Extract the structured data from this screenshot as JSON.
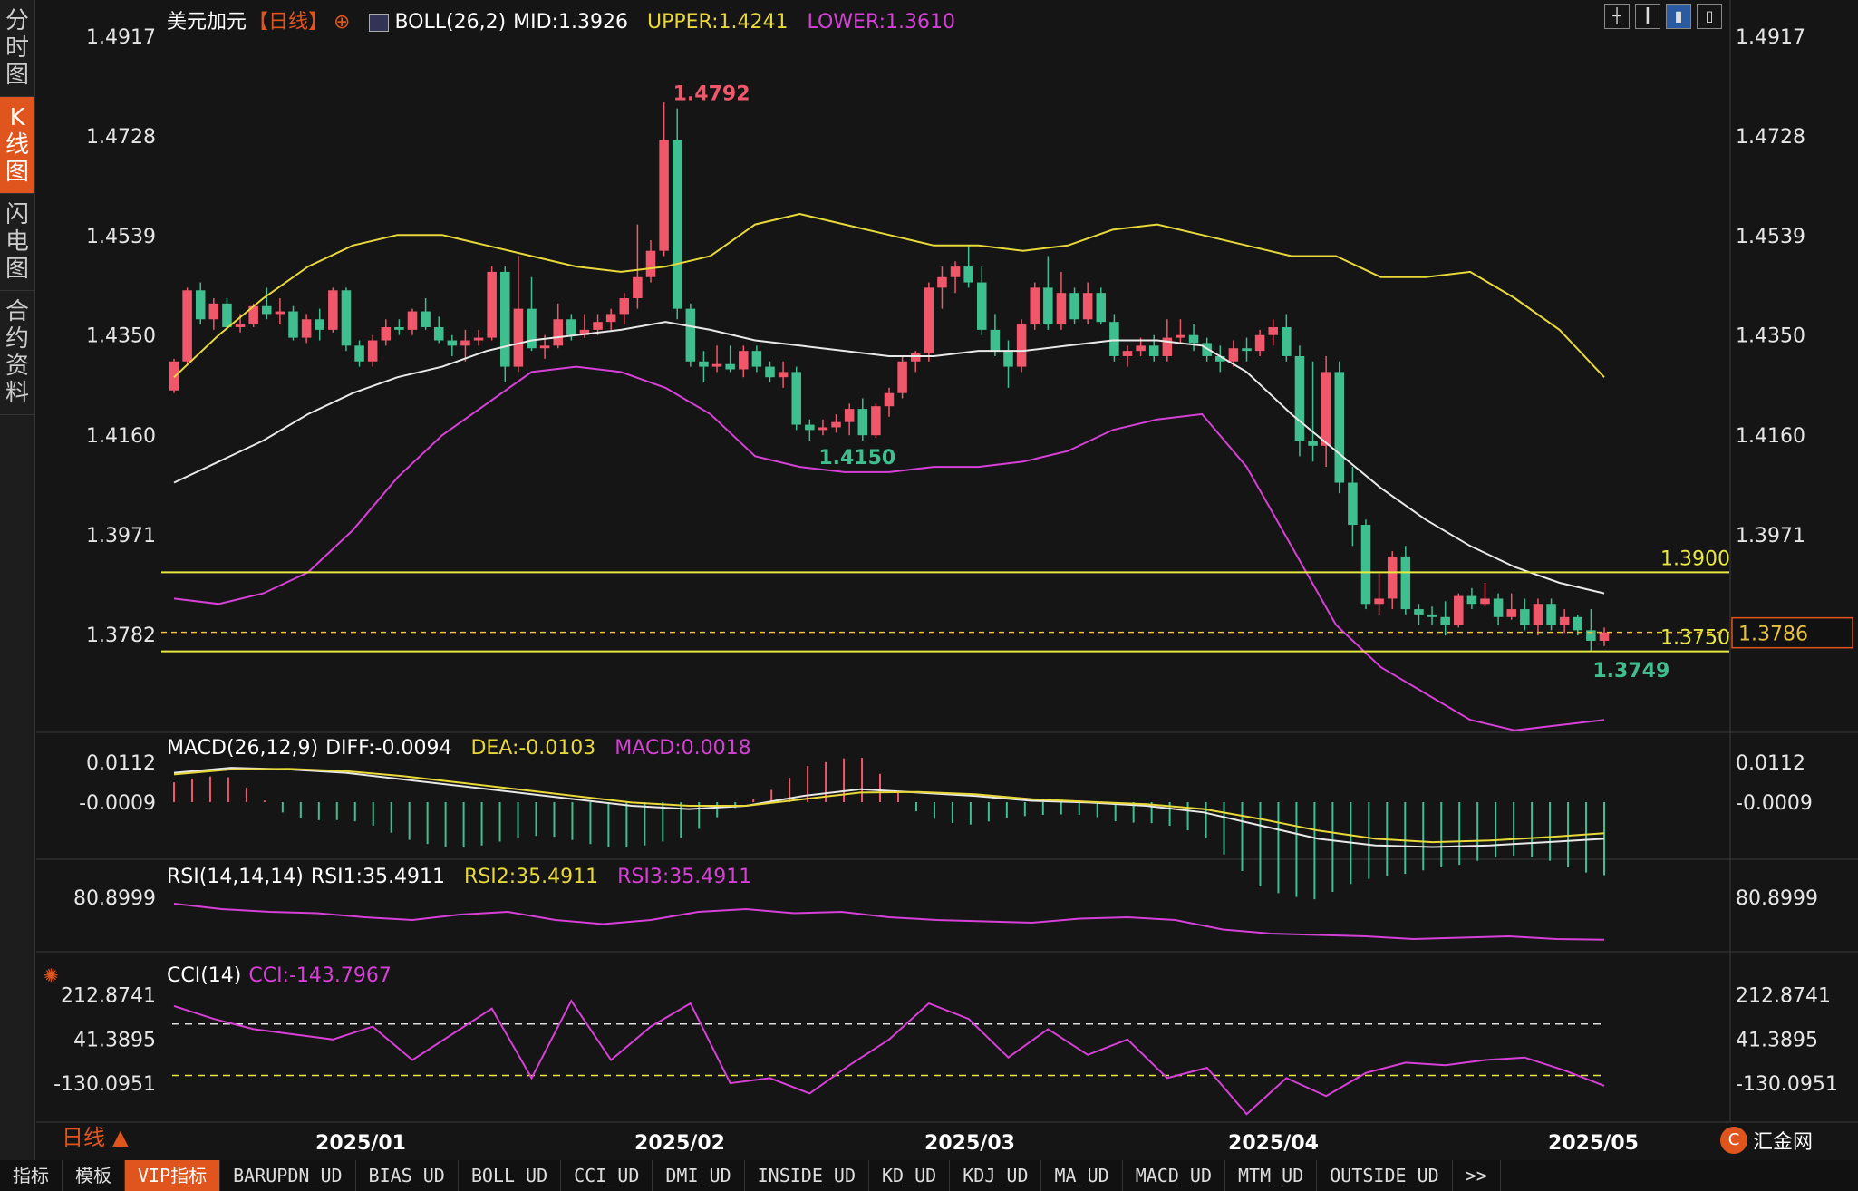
{
  "sidebar": {
    "tabs": [
      {
        "label": "分时图",
        "active": false
      },
      {
        "label": "K线图",
        "active": true
      },
      {
        "label": "闪电图",
        "active": false
      },
      {
        "label": "合约资料",
        "active": false
      }
    ]
  },
  "legend": {
    "symbol": "美元加元",
    "period": "【日线】",
    "boll_name": "BOLL(26,2)",
    "boll_mid": "MID:1.3926",
    "boll_upper": "UPPER:1.4241",
    "boll_lower": "LOWER:1.3610",
    "macd_name": "MACD(26,12,9)",
    "macd_diff": "DIFF:-0.0094",
    "macd_dea": "DEA:-0.0103",
    "macd_macd": "MACD:0.0018",
    "rsi_name": "RSI(14,14,14)",
    "rsi1": "RSI1:35.4911",
    "rsi2": "RSI2:35.4911",
    "rsi3": "RSI3:35.4911",
    "cci_name": "CCI(14)",
    "cci_val": "CCI:-143.7967"
  },
  "colors": {
    "up": "#f0576a",
    "down": "#3fbf8f",
    "upper": "#e8d83a",
    "mid": "#e8e8e8",
    "lower": "#d640d6",
    "hline": "#e8e840",
    "accent": "#e0551d"
  },
  "price_axis": [
    "1.4917",
    "1.4728",
    "1.4539",
    "1.4350",
    "1.4160",
    "1.3971",
    "1.3782"
  ],
  "macd_axis": [
    "0.0112",
    "-0.0009"
  ],
  "rsi_axis": [
    "80.8999"
  ],
  "cci_axis": [
    "212.8741",
    "41.3895",
    "-130.0951"
  ],
  "date_labels": [
    "2025/01",
    "2025/02",
    "2025/03",
    "2025/04",
    "2025/05"
  ],
  "annotations": {
    "high": "1.4792",
    "low_feb": "1.4150",
    "low_may": "1.3749",
    "hline_1": "1.3900",
    "hline_2": "1.3750",
    "current": "1.3786"
  },
  "chart_data": {
    "type": "candlestick",
    "price_range": [
      1.361,
      1.4917
    ],
    "highlights": {
      "high": 1.4792,
      "low_feb": 1.415,
      "low_may": 1.3749,
      "current": 1.3786
    },
    "horizontal_lines": [
      1.39,
      1.375
    ],
    "candles": [
      {
        "o": 1.4245,
        "h": 1.4305,
        "l": 1.424,
        "c": 1.43
      },
      {
        "o": 1.43,
        "h": 1.444,
        "l": 1.4295,
        "c": 1.4435
      },
      {
        "o": 1.4435,
        "h": 1.445,
        "l": 1.437,
        "c": 1.438
      },
      {
        "o": 1.438,
        "h": 1.442,
        "l": 1.436,
        "c": 1.441
      },
      {
        "o": 1.441,
        "h": 1.442,
        "l": 1.436,
        "c": 1.4365
      },
      {
        "o": 1.4365,
        "h": 1.439,
        "l": 1.4355,
        "c": 1.437
      },
      {
        "o": 1.437,
        "h": 1.441,
        "l": 1.4365,
        "c": 1.4405
      },
      {
        "o": 1.4405,
        "h": 1.444,
        "l": 1.438,
        "c": 1.439
      },
      {
        "o": 1.439,
        "h": 1.442,
        "l": 1.437,
        "c": 1.4395
      },
      {
        "o": 1.4395,
        "h": 1.4405,
        "l": 1.434,
        "c": 1.4345
      },
      {
        "o": 1.4345,
        "h": 1.439,
        "l": 1.4335,
        "c": 1.438
      },
      {
        "o": 1.438,
        "h": 1.44,
        "l": 1.434,
        "c": 1.436
      },
      {
        "o": 1.436,
        "h": 1.444,
        "l": 1.4355,
        "c": 1.4435
      },
      {
        "o": 1.4435,
        "h": 1.444,
        "l": 1.432,
        "c": 1.433
      },
      {
        "o": 1.433,
        "h": 1.434,
        "l": 1.429,
        "c": 1.43
      },
      {
        "o": 1.43,
        "h": 1.435,
        "l": 1.429,
        "c": 1.434
      },
      {
        "o": 1.434,
        "h": 1.438,
        "l": 1.433,
        "c": 1.4365
      },
      {
        "o": 1.4365,
        "h": 1.438,
        "l": 1.435,
        "c": 1.436
      },
      {
        "o": 1.436,
        "h": 1.44,
        "l": 1.435,
        "c": 1.4395
      },
      {
        "o": 1.4395,
        "h": 1.442,
        "l": 1.436,
        "c": 1.4365
      },
      {
        "o": 1.4365,
        "h": 1.4385,
        "l": 1.4335,
        "c": 1.434
      },
      {
        "o": 1.434,
        "h": 1.435,
        "l": 1.431,
        "c": 1.433
      },
      {
        "o": 1.433,
        "h": 1.436,
        "l": 1.43,
        "c": 1.434
      },
      {
        "o": 1.434,
        "h": 1.436,
        "l": 1.433,
        "c": 1.4345
      },
      {
        "o": 1.4345,
        "h": 1.448,
        "l": 1.434,
        "c": 1.447
      },
      {
        "o": 1.447,
        "h": 1.448,
        "l": 1.426,
        "c": 1.429
      },
      {
        "o": 1.429,
        "h": 1.45,
        "l": 1.428,
        "c": 1.44
      },
      {
        "o": 1.44,
        "h": 1.446,
        "l": 1.432,
        "c": 1.4325
      },
      {
        "o": 1.4325,
        "h": 1.435,
        "l": 1.4305,
        "c": 1.433
      },
      {
        "o": 1.433,
        "h": 1.441,
        "l": 1.4325,
        "c": 1.438
      },
      {
        "o": 1.438,
        "h": 1.439,
        "l": 1.434,
        "c": 1.435
      },
      {
        "o": 1.435,
        "h": 1.439,
        "l": 1.4345,
        "c": 1.436
      },
      {
        "o": 1.436,
        "h": 1.439,
        "l": 1.435,
        "c": 1.4375
      },
      {
        "o": 1.4375,
        "h": 1.44,
        "l": 1.436,
        "c": 1.439
      },
      {
        "o": 1.439,
        "h": 1.443,
        "l": 1.437,
        "c": 1.442
      },
      {
        "o": 1.442,
        "h": 1.456,
        "l": 1.44,
        "c": 1.446
      },
      {
        "o": 1.446,
        "h": 1.453,
        "l": 1.445,
        "c": 1.451
      },
      {
        "o": 1.451,
        "h": 1.4792,
        "l": 1.45,
        "c": 1.472
      },
      {
        "o": 1.472,
        "h": 1.478,
        "l": 1.438,
        "c": 1.44
      },
      {
        "o": 1.44,
        "h": 1.441,
        "l": 1.429,
        "c": 1.43
      },
      {
        "o": 1.43,
        "h": 1.432,
        "l": 1.426,
        "c": 1.429
      },
      {
        "o": 1.429,
        "h": 1.433,
        "l": 1.428,
        "c": 1.4295
      },
      {
        "o": 1.4295,
        "h": 1.433,
        "l": 1.428,
        "c": 1.4285
      },
      {
        "o": 1.4285,
        "h": 1.433,
        "l": 1.427,
        "c": 1.432
      },
      {
        "o": 1.432,
        "h": 1.433,
        "l": 1.428,
        "c": 1.429
      },
      {
        "o": 1.429,
        "h": 1.43,
        "l": 1.426,
        "c": 1.427
      },
      {
        "o": 1.427,
        "h": 1.43,
        "l": 1.425,
        "c": 1.428
      },
      {
        "o": 1.428,
        "h": 1.429,
        "l": 1.417,
        "c": 1.418
      },
      {
        "o": 1.418,
        "h": 1.419,
        "l": 1.415,
        "c": 1.417
      },
      {
        "o": 1.417,
        "h": 1.419,
        "l": 1.416,
        "c": 1.4175
      },
      {
        "o": 1.4175,
        "h": 1.42,
        "l": 1.4165,
        "c": 1.4185
      },
      {
        "o": 1.4185,
        "h": 1.422,
        "l": 1.416,
        "c": 1.421
      },
      {
        "o": 1.421,
        "h": 1.423,
        "l": 1.415,
        "c": 1.416
      },
      {
        "o": 1.416,
        "h": 1.422,
        "l": 1.4155,
        "c": 1.4215
      },
      {
        "o": 1.4215,
        "h": 1.425,
        "l": 1.4195,
        "c": 1.424
      },
      {
        "o": 1.424,
        "h": 1.431,
        "l": 1.423,
        "c": 1.43
      },
      {
        "o": 1.43,
        "h": 1.432,
        "l": 1.428,
        "c": 1.4315
      },
      {
        "o": 1.4315,
        "h": 1.445,
        "l": 1.43,
        "c": 1.444
      },
      {
        "o": 1.444,
        "h": 1.448,
        "l": 1.44,
        "c": 1.446
      },
      {
        "o": 1.446,
        "h": 1.449,
        "l": 1.443,
        "c": 1.448
      },
      {
        "o": 1.448,
        "h": 1.452,
        "l": 1.444,
        "c": 1.445
      },
      {
        "o": 1.445,
        "h": 1.448,
        "l": 1.435,
        "c": 1.436
      },
      {
        "o": 1.436,
        "h": 1.439,
        "l": 1.431,
        "c": 1.432
      },
      {
        "o": 1.432,
        "h": 1.434,
        "l": 1.425,
        "c": 1.429
      },
      {
        "o": 1.429,
        "h": 1.438,
        "l": 1.428,
        "c": 1.437
      },
      {
        "o": 1.437,
        "h": 1.445,
        "l": 1.436,
        "c": 1.444
      },
      {
        "o": 1.444,
        "h": 1.45,
        "l": 1.436,
        "c": 1.437
      },
      {
        "o": 1.437,
        "h": 1.447,
        "l": 1.436,
        "c": 1.443
      },
      {
        "o": 1.443,
        "h": 1.444,
        "l": 1.437,
        "c": 1.438
      },
      {
        "o": 1.438,
        "h": 1.445,
        "l": 1.437,
        "c": 1.443
      },
      {
        "o": 1.443,
        "h": 1.444,
        "l": 1.437,
        "c": 1.4375
      },
      {
        "o": 1.4375,
        "h": 1.439,
        "l": 1.43,
        "c": 1.431
      },
      {
        "o": 1.431,
        "h": 1.433,
        "l": 1.429,
        "c": 1.432
      },
      {
        "o": 1.432,
        "h": 1.4345,
        "l": 1.431,
        "c": 1.433
      },
      {
        "o": 1.433,
        "h": 1.435,
        "l": 1.43,
        "c": 1.431
      },
      {
        "o": 1.431,
        "h": 1.438,
        "l": 1.43,
        "c": 1.4345
      },
      {
        "o": 1.4345,
        "h": 1.438,
        "l": 1.4335,
        "c": 1.435
      },
      {
        "o": 1.435,
        "h": 1.437,
        "l": 1.432,
        "c": 1.4335
      },
      {
        "o": 1.4335,
        "h": 1.4345,
        "l": 1.43,
        "c": 1.431
      },
      {
        "o": 1.431,
        "h": 1.433,
        "l": 1.428,
        "c": 1.43
      },
      {
        "o": 1.43,
        "h": 1.434,
        "l": 1.429,
        "c": 1.4325
      },
      {
        "o": 1.4325,
        "h": 1.4345,
        "l": 1.43,
        "c": 1.432
      },
      {
        "o": 1.432,
        "h": 1.436,
        "l": 1.431,
        "c": 1.435
      },
      {
        "o": 1.435,
        "h": 1.438,
        "l": 1.433,
        "c": 1.4365
      },
      {
        "o": 1.4365,
        "h": 1.439,
        "l": 1.43,
        "c": 1.431
      },
      {
        "o": 1.431,
        "h": 1.433,
        "l": 1.412,
        "c": 1.415
      },
      {
        "o": 1.415,
        "h": 1.43,
        "l": 1.411,
        "c": 1.414
      },
      {
        "o": 1.414,
        "h": 1.431,
        "l": 1.41,
        "c": 1.428
      },
      {
        "o": 1.428,
        "h": 1.43,
        "l": 1.405,
        "c": 1.407
      },
      {
        "o": 1.407,
        "h": 1.41,
        "l": 1.395,
        "c": 1.399
      },
      {
        "o": 1.399,
        "h": 1.4,
        "l": 1.383,
        "c": 1.384
      },
      {
        "o": 1.384,
        "h": 1.39,
        "l": 1.382,
        "c": 1.385
      },
      {
        "o": 1.385,
        "h": 1.394,
        "l": 1.383,
        "c": 1.393
      },
      {
        "o": 1.393,
        "h": 1.395,
        "l": 1.382,
        "c": 1.383
      },
      {
        "o": 1.383,
        "h": 1.384,
        "l": 1.38,
        "c": 1.382
      },
      {
        "o": 1.382,
        "h": 1.3835,
        "l": 1.38,
        "c": 1.3815
      },
      {
        "o": 1.3815,
        "h": 1.3845,
        "l": 1.378,
        "c": 1.38
      },
      {
        "o": 1.38,
        "h": 1.386,
        "l": 1.3795,
        "c": 1.3855
      },
      {
        "o": 1.3855,
        "h": 1.387,
        "l": 1.383,
        "c": 1.384
      },
      {
        "o": 1.384,
        "h": 1.388,
        "l": 1.3835,
        "c": 1.385
      },
      {
        "o": 1.385,
        "h": 1.386,
        "l": 1.38,
        "c": 1.3815
      },
      {
        "o": 1.3815,
        "h": 1.386,
        "l": 1.381,
        "c": 1.383
      },
      {
        "o": 1.383,
        "h": 1.385,
        "l": 1.379,
        "c": 1.38
      },
      {
        "o": 1.38,
        "h": 1.385,
        "l": 1.378,
        "c": 1.384
      },
      {
        "o": 1.384,
        "h": 1.385,
        "l": 1.379,
        "c": 1.38
      },
      {
        "o": 1.38,
        "h": 1.383,
        "l": 1.3785,
        "c": 1.3815
      },
      {
        "o": 1.3815,
        "h": 1.382,
        "l": 1.378,
        "c": 1.379
      },
      {
        "o": 1.379,
        "h": 1.383,
        "l": 1.3749,
        "c": 1.377
      },
      {
        "o": 1.377,
        "h": 1.3795,
        "l": 1.376,
        "c": 1.3786
      }
    ],
    "boll_upper": [
      1.427,
      1.435,
      1.442,
      1.448,
      1.452,
      1.454,
      1.454,
      1.452,
      1.45,
      1.448,
      1.447,
      1.448,
      1.45,
      1.456,
      1.458,
      1.456,
      1.454,
      1.452,
      1.452,
      1.451,
      1.452,
      1.455,
      1.456,
      1.454,
      1.452,
      1.45,
      1.45,
      1.446,
      1.446,
      1.447,
      1.442,
      1.436,
      1.427
    ],
    "boll_mid": [
      1.407,
      1.411,
      1.415,
      1.42,
      1.424,
      1.427,
      1.429,
      1.432,
      1.434,
      1.435,
      1.436,
      1.4375,
      1.436,
      1.434,
      1.433,
      1.432,
      1.431,
      1.431,
      1.432,
      1.432,
      1.433,
      1.434,
      1.434,
      1.433,
      1.428,
      1.42,
      1.413,
      1.406,
      1.4,
      1.395,
      1.391,
      1.388,
      1.386
    ],
    "boll_lower": [
      1.385,
      1.384,
      1.386,
      1.39,
      1.398,
      1.408,
      1.416,
      1.422,
      1.428,
      1.429,
      1.428,
      1.425,
      1.42,
      1.412,
      1.41,
      1.409,
      1.409,
      1.41,
      1.41,
      1.411,
      1.413,
      1.417,
      1.419,
      1.42,
      1.41,
      1.395,
      1.38,
      1.372,
      1.367,
      1.362,
      1.36,
      1.361,
      1.362
    ],
    "macd_diff": [
      0.008,
      0.0095,
      0.009,
      0.008,
      0.006,
      0.004,
      0.002,
      0.0,
      -0.002,
      -0.003,
      -0.002,
      0.001,
      0.003,
      0.002,
      0.001,
      -0.0005,
      -0.001,
      -0.002,
      -0.004,
      -0.008,
      -0.012,
      -0.014,
      -0.0145,
      -0.014,
      -0.013,
      -0.012
    ],
    "macd_dea": [
      0.0075,
      0.009,
      0.0092,
      0.0085,
      0.007,
      0.005,
      0.003,
      0.001,
      -0.001,
      -0.002,
      -0.002,
      0.0,
      0.002,
      0.0022,
      0.0015,
      0.0,
      -0.0008,
      -0.0015,
      -0.003,
      -0.006,
      -0.0095,
      -0.012,
      -0.013,
      -0.0125,
      -0.0115,
      -0.0103
    ],
    "rsi": [
      62,
      58,
      56,
      55,
      52,
      50,
      54,
      56,
      50,
      47,
      50,
      56,
      58,
      55,
      56,
      52,
      50,
      49,
      48,
      51,
      52,
      50,
      43,
      40,
      39,
      38,
      36,
      37,
      38,
      36,
      35.5
    ],
    "cci": [
      170,
      120,
      80,
      60,
      40,
      90,
      -40,
      60,
      160,
      -110,
      190,
      -40,
      90,
      180,
      -130,
      -110,
      -170,
      -60,
      40,
      180,
      120,
      -30,
      80,
      -20,
      40,
      -110,
      -70,
      -250,
      -110,
      -180,
      -90,
      -50,
      -60,
      -40,
      -30,
      -80,
      -140
    ]
  },
  "toolbar_icons": [
    "crosshair-icon",
    "candle-bars-icon",
    "candle-up-icon",
    "candle-down-icon"
  ],
  "bottom_tabs": [
    {
      "label": "指标",
      "active": false
    },
    {
      "label": "模板",
      "active": false
    },
    {
      "label": "VIP指标",
      "active": true
    },
    {
      "label": "BARUPDN_UD",
      "active": false
    },
    {
      "label": "BIAS_UD",
      "active": false
    },
    {
      "label": "BOLL_UD",
      "active": false
    },
    {
      "label": "CCI_UD",
      "active": false
    },
    {
      "label": "DMI_UD",
      "active": false
    },
    {
      "label": "INSIDE_UD",
      "active": false
    },
    {
      "label": "KD_UD",
      "active": false
    },
    {
      "label": "KDJ_UD",
      "active": false
    },
    {
      "label": "MA_UD",
      "active": false
    },
    {
      "label": "MACD_UD",
      "active": false
    },
    {
      "label": "MTM_UD",
      "active": false
    },
    {
      "label": "OUTSIDE_UD",
      "active": false
    },
    {
      "label": ">>",
      "active": false
    }
  ],
  "period_label": "日线 ▲",
  "brand": "汇金网"
}
